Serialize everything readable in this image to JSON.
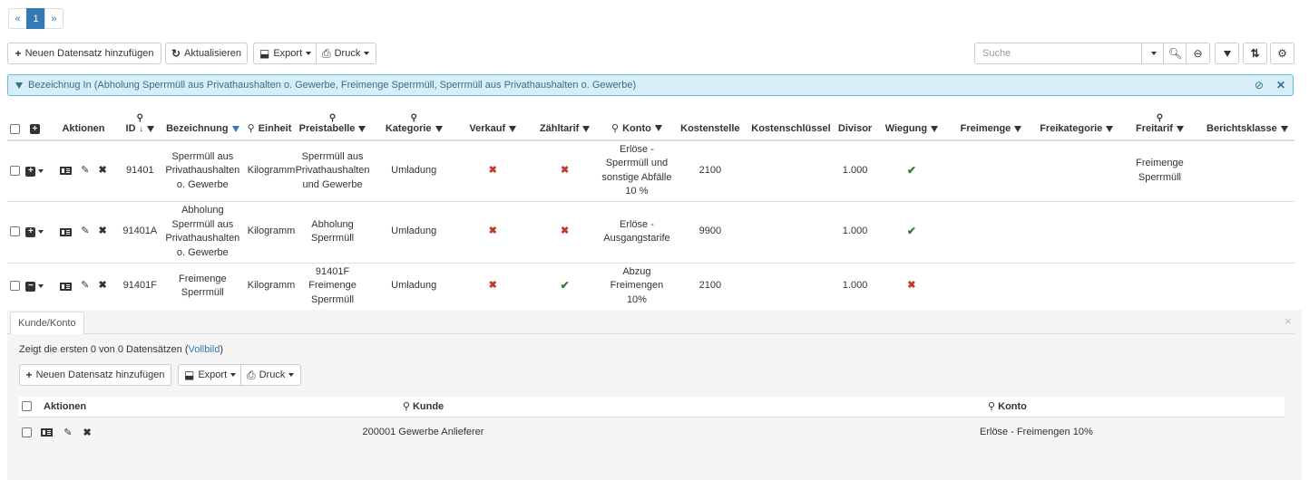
{
  "pagination": {
    "prev": "«",
    "current": "1",
    "next": "»"
  },
  "toolbar": {
    "add_label": "Neuen Datensatz hinzufügen",
    "refresh_label": "Aktualisieren",
    "export_label": "Export",
    "print_label": "Druck",
    "search_placeholder": "Suche"
  },
  "filter": {
    "text": "Bezeichnug In (Abholung Sperrmüll aus Privathaushalten o. Gewerbe, Freimenge Sperrmüll, Sperrmüll aus Privathaushalten o. Gewerbe)"
  },
  "table": {
    "headers": {
      "aktionen": "Aktionen",
      "id": "ID",
      "bezeichnung": "Bezeichnung",
      "einheit": "Einheit",
      "preistabelle": "Preistabelle",
      "kategorie": "Kategorie",
      "verkauf": "Verkauf",
      "zaehltarif": "Zähltarif",
      "konto": "Konto",
      "kostenstelle": "Kostenstelle",
      "kostenschluessel": "Kostenschlüssel",
      "divisor": "Divisor",
      "wiegung": "Wiegung",
      "freimenge": "Freimenge",
      "freikategorie": "Freikategorie",
      "freitarif": "Freitarif",
      "berichtsklasse": "Berichtsklasse"
    },
    "rows": [
      {
        "id": "91401",
        "bezeichnung": "Sperrmüll aus Privathaushalten o. Gewerbe",
        "einheit": "Kilogramm",
        "preistabelle": "Sperrmüll aus Privathaushalten und Gewerbe",
        "kategorie": "Umladung",
        "verkauf": "✖",
        "zaehltarif": "✖",
        "konto": "Erlöse - Sperrmüll und sonstige Abfälle 10 %",
        "kostenstelle": "2100",
        "kostenschluessel": "",
        "divisor": "1.000",
        "wiegung": "✔",
        "freimenge": "",
        "freikategorie": "",
        "freitarif": "Freimenge Sperrmüll",
        "berichtsklasse": ""
      },
      {
        "id": "91401A",
        "bezeichnung": "Abholung Sperrmüll aus Privathaushalten o. Gewerbe",
        "einheit": "Kilogramm",
        "preistabelle": "Abholung Sperrmüll",
        "kategorie": "Umladung",
        "verkauf": "✖",
        "zaehltarif": "✖",
        "konto": "Erlöse - Ausgangstarife",
        "kostenstelle": "9900",
        "kostenschluessel": "",
        "divisor": "1.000",
        "wiegung": "✔",
        "freimenge": "",
        "freikategorie": "",
        "freitarif": "",
        "berichtsklasse": ""
      },
      {
        "id": "91401F",
        "bezeichnung": "Freimenge Sperrmüll",
        "einheit": "Kilogramm",
        "preistabelle": "91401F Freimenge Sperrmüll",
        "kategorie": "Umladung",
        "verkauf": "✖",
        "zaehltarif": "✔",
        "konto": "Abzug Freimengen 10%",
        "kostenstelle": "2100",
        "kostenschluessel": "",
        "divisor": "1.000",
        "wiegung": "✖",
        "freimenge": "",
        "freikategorie": "",
        "freitarif": "",
        "berichtsklasse": ""
      }
    ]
  },
  "sub": {
    "tab_label": "Kunde/Konto",
    "close": "×",
    "info_prefix": "Zeigt die ersten 0 von 0 Datensätzen (",
    "info_link": "Vollbild",
    "info_suffix": ")",
    "add_label": "Neuen Datensatz hinzufügen",
    "export_label": "Export",
    "print_label": "Druck",
    "headers": {
      "aktionen": "Aktionen",
      "kunde": "Kunde",
      "konto": "Konto"
    },
    "rows": [
      {
        "kunde": "200001 Gewerbe Anlieferer",
        "konto": "Erlöse - Freimengen 10%"
      }
    ]
  }
}
